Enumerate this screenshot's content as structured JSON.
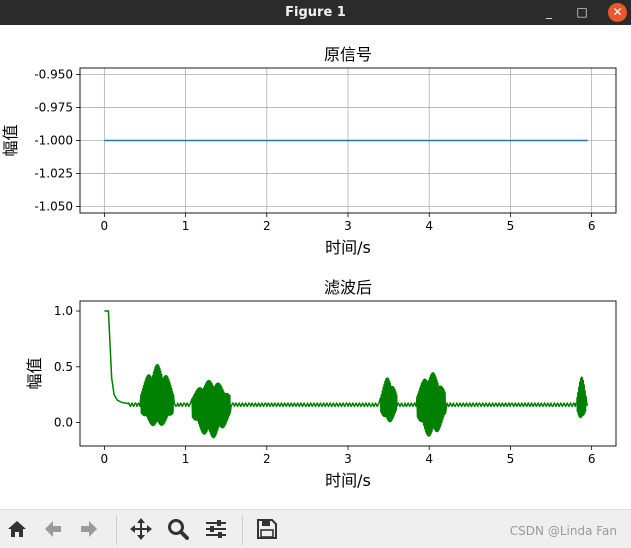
{
  "window": {
    "title": "Figure 1",
    "minimize": "_",
    "maximize": "□",
    "close": "✕"
  },
  "toolbar": {
    "buttons": [
      {
        "name": "home-button",
        "icon": "home-icon"
      },
      {
        "name": "back-button",
        "icon": "arrow-left-icon"
      },
      {
        "name": "forward-button",
        "icon": "arrow-right-icon"
      },
      {
        "name": "pan-button",
        "icon": "move-icon"
      },
      {
        "name": "zoom-button",
        "icon": "magnifier-icon"
      },
      {
        "name": "configure-subplots-button",
        "icon": "sliders-icon"
      },
      {
        "name": "save-button",
        "icon": "floppy-disk-icon"
      }
    ],
    "watermark": "CSDN @Linda Fan"
  },
  "chart_data": [
    {
      "type": "line",
      "title": "原信号",
      "xlabel": "时间/s",
      "ylabel": "幅值",
      "xlim": [
        -0.3,
        6.3
      ],
      "ylim": [
        -1.055,
        -0.945
      ],
      "xticks": [
        0,
        1,
        2,
        3,
        4,
        5,
        6
      ],
      "yticks": [
        -0.95,
        -0.975,
        -1.0,
        -1.025,
        -1.05
      ],
      "ytick_labels": [
        "-0.950",
        "-0.975",
        "-1.000",
        "-1.025",
        "-1.050"
      ],
      "grid": true,
      "series": [
        {
          "color": "#1f77b4",
          "x": [
            0,
            5.95
          ],
          "y": [
            -1.0,
            -1.0
          ]
        }
      ]
    },
    {
      "type": "line",
      "title": "滤波后",
      "xlabel": "时间/s",
      "ylabel": "幅值",
      "xlim": [
        -0.3,
        6.3
      ],
      "ylim": [
        -0.21,
        1.09
      ],
      "xticks": [
        0,
        1,
        2,
        3,
        4,
        5,
        6
      ],
      "yticks": [
        0.0,
        0.5,
        1.0
      ],
      "ytick_labels": [
        "0.0",
        "0.5",
        "1.0"
      ],
      "grid": false,
      "series": [
        {
          "color": "#008000",
          "x": [
            0,
            0.05,
            0.07,
            0.09,
            0.12,
            0.16,
            0.22,
            0.3,
            0.4,
            0.5,
            0.6,
            0.75,
            0.9,
            1.0,
            1.2,
            1.4,
            1.6,
            1.8,
            2.0,
            2.5,
            3.0,
            3.3,
            3.5,
            3.7,
            4.0,
            4.3,
            4.6,
            5.0,
            5.5,
            5.8,
            5.95
          ],
          "y": [
            1.0,
            1.0,
            0.7,
            0.4,
            0.25,
            0.2,
            0.18,
            0.17,
            0.16,
            0.16,
            0.16,
            0.16,
            0.16,
            0.16,
            0.15,
            0.16,
            0.16,
            0.16,
            0.16,
            0.16,
            0.16,
            0.16,
            0.16,
            0.16,
            0.16,
            0.16,
            0.16,
            0.16,
            0.16,
            0.17,
            0.15
          ]
        }
      ],
      "bursts": [
        {
          "x0": 0.45,
          "x1": 0.85,
          "lo": -0.04,
          "hi": 0.52
        },
        {
          "x0": 1.08,
          "x1": 1.55,
          "lo": -0.14,
          "hi": 0.38
        },
        {
          "x0": 3.4,
          "x1": 3.6,
          "lo": 0.0,
          "hi": 0.41
        },
        {
          "x0": 3.85,
          "x1": 4.2,
          "lo": -0.13,
          "hi": 0.45
        },
        {
          "x0": 5.82,
          "x1": 5.93,
          "lo": 0.02,
          "hi": 0.41
        }
      ]
    }
  ]
}
